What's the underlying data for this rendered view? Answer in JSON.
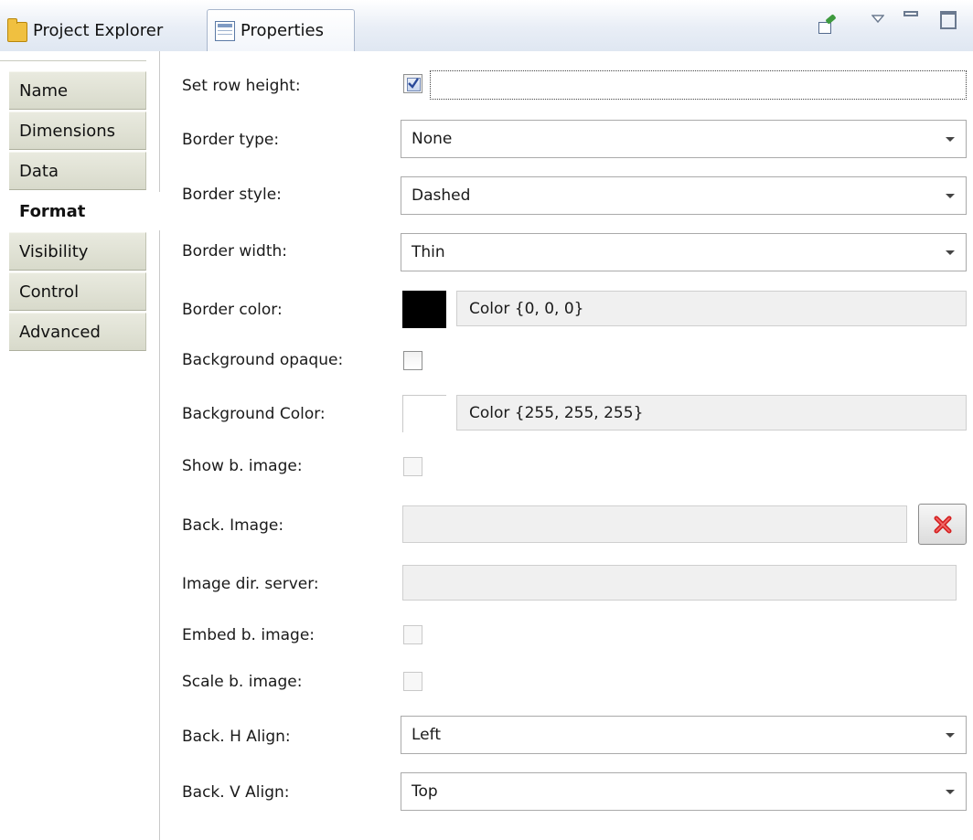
{
  "tabs": {
    "project_explorer": "Project Explorer",
    "properties": "Properties"
  },
  "toolbar": {
    "icons": [
      "pin-icon",
      "view-menu-icon",
      "minimize-icon",
      "maximize-icon"
    ]
  },
  "nav": {
    "items": [
      {
        "label": "Name",
        "active": false
      },
      {
        "label": "Dimensions",
        "active": false
      },
      {
        "label": "Data",
        "active": false
      },
      {
        "label": "Format",
        "active": true
      },
      {
        "label": "Visibility",
        "active": false
      },
      {
        "label": "Control",
        "active": false
      },
      {
        "label": "Advanced",
        "active": false
      }
    ]
  },
  "form": {
    "set_row_height": {
      "label": "Set row height:",
      "checked": true,
      "value": ""
    },
    "border_type": {
      "label": "Border type:",
      "value": "None"
    },
    "border_style": {
      "label": "Border style:",
      "value": "Dashed"
    },
    "border_width": {
      "label": "Border width:",
      "value": "Thin"
    },
    "border_color": {
      "label": "Border color:",
      "swatch": "#000000",
      "value": "Color {0, 0, 0}"
    },
    "background_opaque": {
      "label": "Background opaque:",
      "checked": false
    },
    "background_color": {
      "label": "Background Color:",
      "swatch": "#ffffff",
      "value": "Color {255, 255, 255}"
    },
    "show_b_image": {
      "label": "Show b. image:",
      "checked": false,
      "enabled": false
    },
    "back_image": {
      "label": "Back. Image:",
      "value": ""
    },
    "image_dir_server": {
      "label": "Image dir. server:",
      "value": ""
    },
    "embed_b_image": {
      "label": "Embed b. image:",
      "checked": false,
      "enabled": false
    },
    "scale_b_image": {
      "label": "Scale b. image:",
      "checked": false,
      "enabled": false
    },
    "back_h_align": {
      "label": "Back. H Align:",
      "value": "Left"
    },
    "back_v_align": {
      "label": "Back. V Align:",
      "value": "Top"
    }
  }
}
